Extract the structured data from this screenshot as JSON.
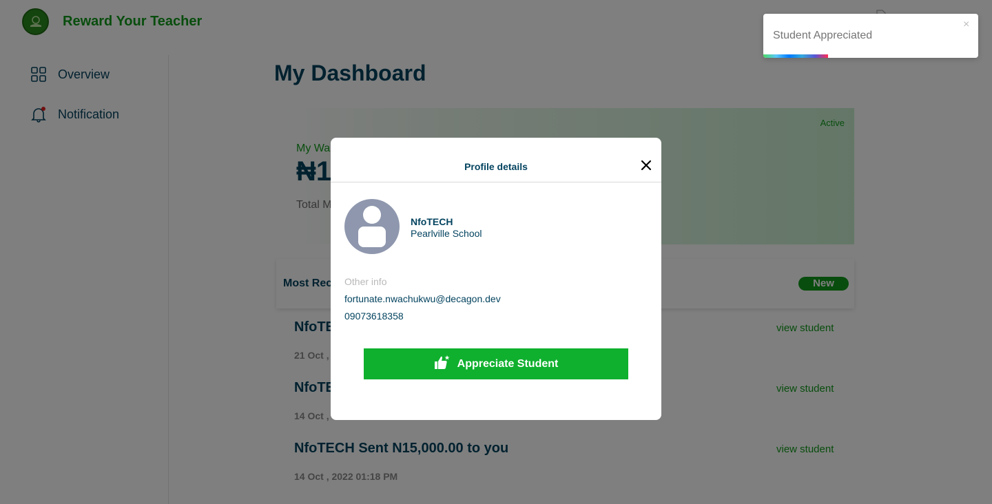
{
  "app": {
    "brand": "Reward Your Teacher"
  },
  "sidebar": {
    "items": [
      {
        "label": "Overview",
        "icon": "grid-icon"
      },
      {
        "label": "Notification",
        "icon": "bell-icon"
      }
    ]
  },
  "main": {
    "title": "My Dashboard",
    "wallet": {
      "status": "Active",
      "label": "My Wa",
      "amount": "₦1",
      "sub_label": "Total M"
    },
    "recent": {
      "title": "Most Rec",
      "badge": "New"
    },
    "transactions": [
      {
        "title": "NfoTE",
        "date": "21 Oct ,",
        "link": "view student"
      },
      {
        "title": "NfoTE",
        "date": "14 Oct ,",
        "link": "view student"
      },
      {
        "title": "NfoTECH Sent N15,000.00 to you",
        "date": "14 Oct , 2022 01:18 PM",
        "link": "view student"
      }
    ]
  },
  "modal": {
    "title": "Profile details",
    "name": "NfoTECH",
    "school": "Pearlville School",
    "other_info_label": "Other info",
    "email": "fortunate.nwachukwu@decagon.dev",
    "phone": "09073618358",
    "button_label": "Appreciate Student"
  },
  "toast": {
    "message": "Student Appreciated",
    "close_symbol": "×",
    "progress": 0.3
  },
  "colors": {
    "brand_green": "#109a1a",
    "button_green": "#0fb02e",
    "navy": "#03435f"
  }
}
